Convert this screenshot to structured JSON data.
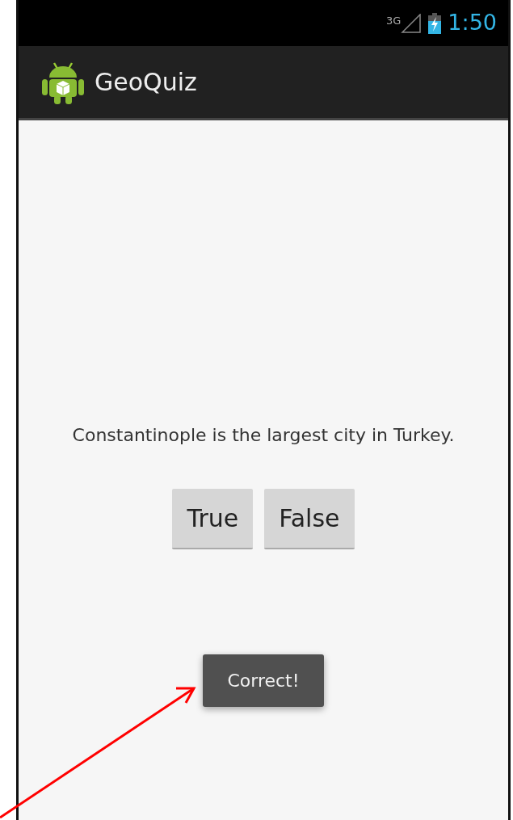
{
  "status_bar": {
    "network": "3G",
    "time": "1:50"
  },
  "app_bar": {
    "title": "GeoQuiz"
  },
  "question": "Constantinople is the largest city in Turkey.",
  "buttons": [
    {
      "label": "True"
    },
    {
      "label": "False"
    }
  ],
  "toast": "Correct!"
}
